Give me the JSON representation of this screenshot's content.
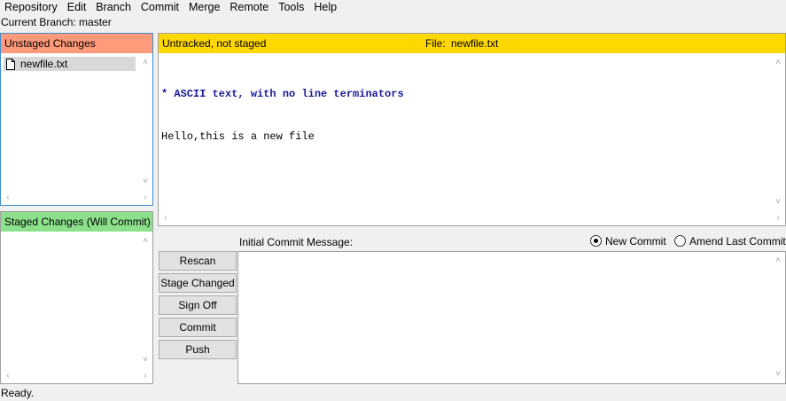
{
  "menu": [
    "Repository",
    "Edit",
    "Branch",
    "Commit",
    "Merge",
    "Remote",
    "Tools",
    "Help"
  ],
  "branch_label": "Current Branch: master",
  "unstaged": {
    "header": "Unstaged Changes",
    "header_color": "#ff9a7a",
    "files": [
      "newfile.txt"
    ]
  },
  "staged": {
    "header": "Staged Changes (Will Commit)",
    "header_color": "#8ce08c"
  },
  "diff": {
    "status": "Untracked, not staged",
    "file_label": "File:",
    "file_name": "newfile.txt",
    "header_color": "#ffd800",
    "lines": [
      "* ASCII text, with no line terminators",
      "Hello,this is a new file"
    ]
  },
  "commit": {
    "message_label": "Initial Commit Message:",
    "options": [
      {
        "label": "New Commit",
        "selected": true
      },
      {
        "label": "Amend Last Commit",
        "selected": false
      }
    ],
    "buttons": [
      "Rescan",
      "Stage Changed",
      "Sign Off",
      "Commit",
      "Push"
    ]
  },
  "status_bar": "Ready."
}
